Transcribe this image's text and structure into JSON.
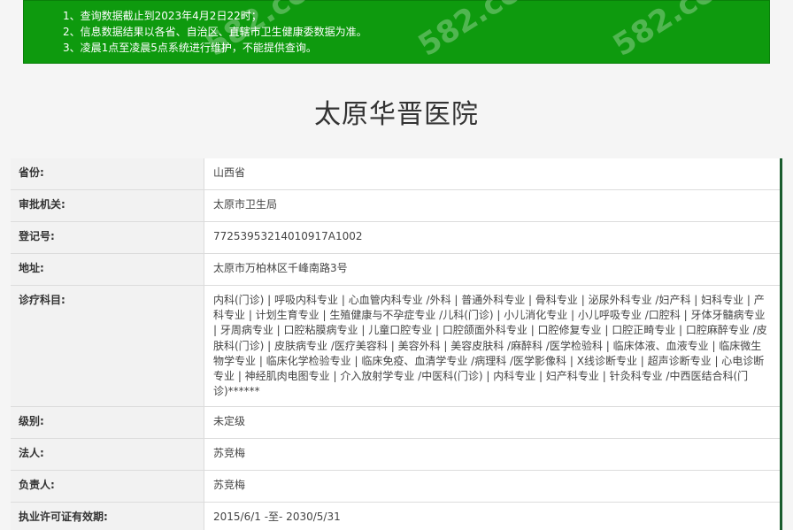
{
  "notice": {
    "lines": [
      "1、查询数据截止到2023年4月2日22时；",
      "2、信息数据结果以各省、自治区、直辖市卫生健康委数据为准。",
      "3、凌晨1点至凌晨5点系统进行维护，不能提供查询。"
    ],
    "watermark": "582.cc"
  },
  "hospital": {
    "title": "太原华晋医院"
  },
  "fields": [
    {
      "label": "省份:",
      "value": "山西省"
    },
    {
      "label": "审批机关:",
      "value": "太原市卫生局"
    },
    {
      "label": "登记号:",
      "value": "77253953214010917A1002"
    },
    {
      "label": "地址:",
      "value": "太原市万柏林区千峰南路3号"
    },
    {
      "label": "诊疗科目:",
      "value": "内科(门诊) | 呼吸内科专业 | 心血管内科专业 /外科 | 普通外科专业 | 骨科专业 | 泌尿外科专业 /妇产科 | 妇科专业 | 产科专业 | 计划生育专业 | 生殖健康与不孕症专业 /儿科(门诊) | 小儿消化专业 | 小儿呼吸专业 /口腔科 | 牙体牙髓病专业 | 牙周病专业 | 口腔粘膜病专业 | 儿童口腔专业 | 口腔颌面外科专业 | 口腔修复专业 | 口腔正畸专业 | 口腔麻醉专业 /皮肤科(门诊) | 皮肤病专业 /医疗美容科 | 美容外科 | 美容皮肤科 /麻醉科 /医学检验科 | 临床体液、血液专业 | 临床微生物学专业 | 临床化学检验专业 | 临床免疫、血清学专业 /病理科 /医学影像科 | X线诊断专业 | 超声诊断专业 | 心电诊断专业 | 神经肌肉电图专业 | 介入放射学专业 /中医科(门诊) | 内科专业 | 妇产科专业 | 针灸科专业 /中西医结合科(门诊)******"
    },
    {
      "label": "级别:",
      "value": "未定级"
    },
    {
      "label": "法人:",
      "value": "苏竞梅"
    },
    {
      "label": "负责人:",
      "value": "苏竞梅"
    },
    {
      "label": "执业许可证有效期:",
      "value": "2015/6/1 -至- 2030/5/31"
    }
  ]
}
